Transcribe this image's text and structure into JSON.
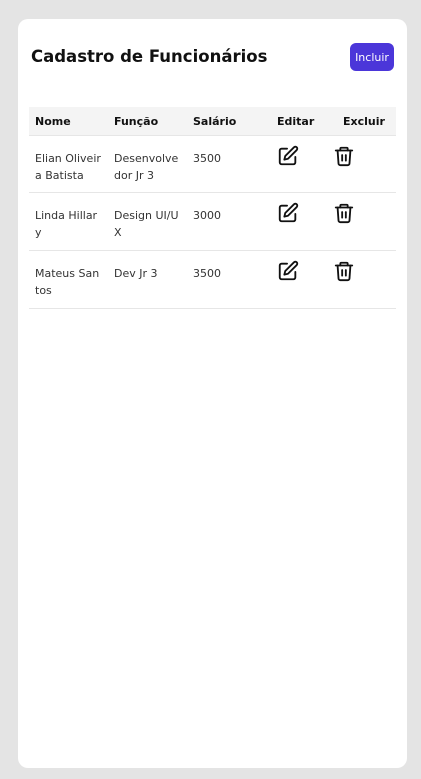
{
  "header": {
    "title": "Cadastro de Funcionários",
    "add_label": "Incluir"
  },
  "table": {
    "columns": [
      "Nome",
      "Função",
      "Salário",
      "Editar",
      "Excluir"
    ],
    "rows": [
      {
        "nome": "Elian Oliveira Batista",
        "funcao": "Desenvolvedor Jr 3",
        "salario": "3500"
      },
      {
        "nome": "Linda Hillary",
        "funcao": "Design UI/UX",
        "salario": "3000"
      },
      {
        "nome": "Mateus Santos",
        "funcao": "Dev Jr 3",
        "salario": "3500"
      }
    ]
  },
  "icons": {
    "edit": "pencil-square-icon",
    "delete": "trash-icon"
  },
  "colors": {
    "accent": "#4b36d9",
    "background": "#e4e4e4",
    "card": "#ffffff",
    "header_row": "#f4f4f4"
  }
}
